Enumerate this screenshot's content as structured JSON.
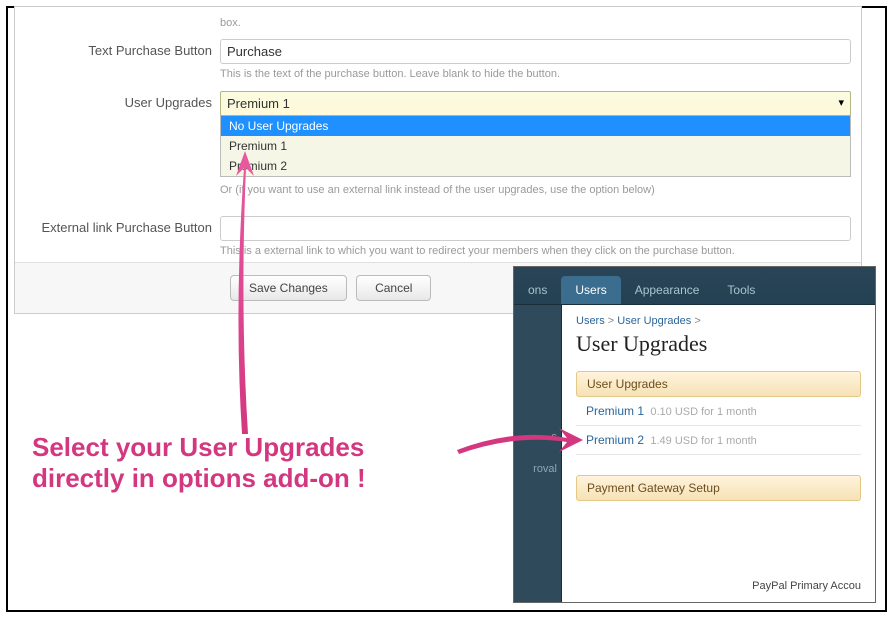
{
  "form": {
    "top_hint_fragment": "box.",
    "text_purchase_label": "Text Purchase Button",
    "text_purchase_value": "Purchase",
    "text_purchase_hint": "This is the text of the purchase button. Leave blank to hide the button.",
    "user_upgrades_label": "User Upgrades",
    "user_upgrades_selected": "Premium 1",
    "user_upgrades_options": [
      "No User Upgrades",
      "Premium 1",
      "Premium 2"
    ],
    "user_upgrades_hint": "Or (if you want to use an external link instead of the user upgrades, use the option below)",
    "external_link_label": "External link Purchase Button",
    "external_link_hint": "This is a external link to which you want to redirect your members when they click on the purchase button.",
    "save_button": "Save Changes",
    "cancel_button": "Cancel"
  },
  "inset": {
    "tabs": {
      "partial": "ons",
      "users": "Users",
      "appearance": "Appearance",
      "tools": "Tools"
    },
    "sidebar_fragments": [
      "s",
      "roval"
    ],
    "breadcrumb": {
      "users": "Users",
      "upgrades": "User Upgrades",
      "sep": ">"
    },
    "title": "User Upgrades",
    "section_upgrades": "User Upgrades",
    "items": [
      {
        "name": "Premium 1",
        "meta": "0.10 USD for 1 month"
      },
      {
        "name": "Premium 2",
        "meta": "1.49 USD for 1 month"
      }
    ],
    "section_payment": "Payment Gateway Setup",
    "footer_fragment": "PayPal Primary Accou"
  },
  "callout": {
    "line1": "Select your User Upgrades",
    "line2": "directly in options add-on !"
  }
}
